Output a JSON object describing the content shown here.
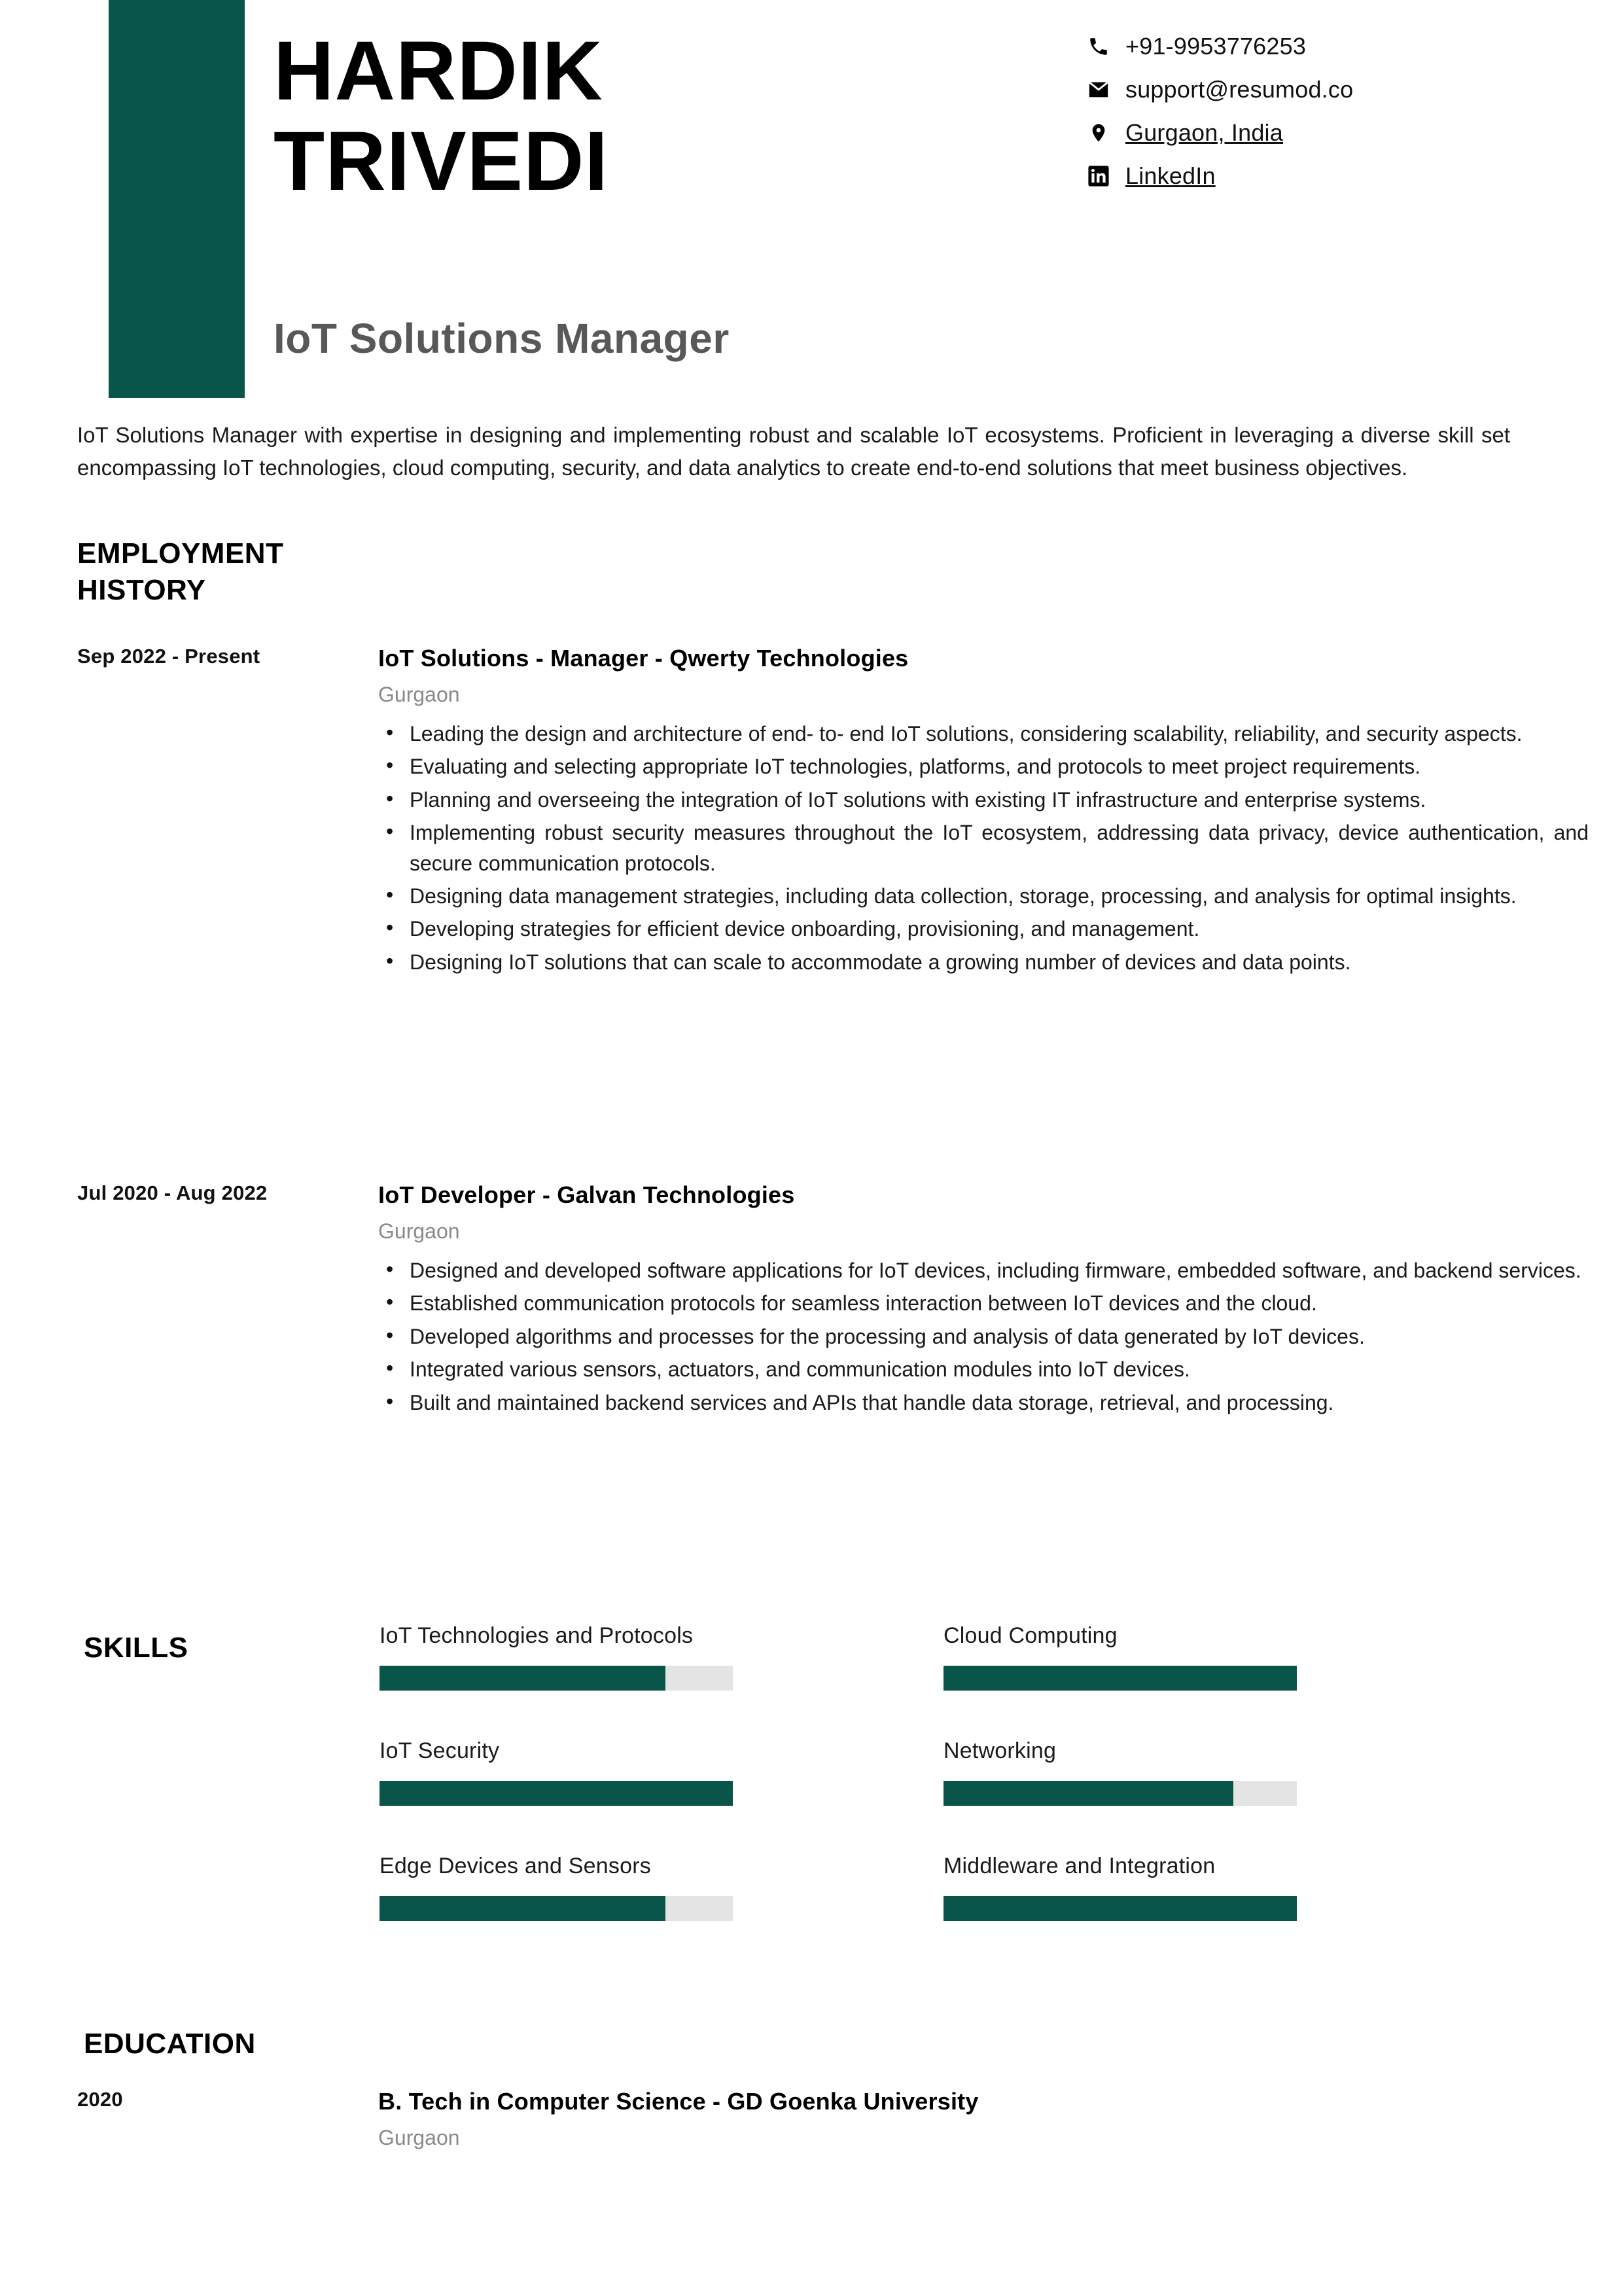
{
  "header": {
    "first_name": "HARDIK",
    "last_name": "TRIVEDI",
    "job_title": "IoT Solutions Manager",
    "accent_color": "#0a5549"
  },
  "contact": [
    {
      "icon": "phone-icon",
      "text": "+91-9953776253",
      "linked": false
    },
    {
      "icon": "envelope-icon",
      "text": "support@resumod.co",
      "linked": false
    },
    {
      "icon": "location-pin-icon",
      "text": "Gurgaon, India",
      "linked": true
    },
    {
      "icon": "linkedin-icon",
      "text": "LinkedIn",
      "linked": true
    }
  ],
  "summary": "IoT Solutions Manager with expertise in designing and implementing robust and scalable IoT ecosystems. Proficient in leveraging a diverse skill set encompassing IoT technologies, cloud computing, security, and data analytics to create end-to-end solutions that meet business objectives.",
  "employment": {
    "section_title": "EMPLOYMENT HISTORY",
    "entries": [
      {
        "date": "Sep 2022 - Present",
        "heading": "IoT Solutions - Manager - Qwerty Technologies",
        "location": "Gurgaon",
        "bullets": [
          "Leading the design and architecture of end- to- end IoT solutions, considering scalability, reliability, and security aspects.",
          "Evaluating and selecting appropriate IoT technologies, platforms, and protocols to meet project requirements.",
          "Planning and overseeing the integration of IoT solutions with existing IT infrastructure and enterprise systems.",
          "Implementing robust security measures throughout the IoT ecosystem, addressing data privacy, device authentication, and secure communication protocols.",
          "Designing data management strategies, including data collection, storage, processing, and analysis for optimal insights.",
          "Developing strategies for efficient device onboarding, provisioning, and management.",
          "Designing IoT solutions that can scale to accommodate a growing number of devices and data points."
        ]
      },
      {
        "date": "Jul 2020 - Aug 2022",
        "heading": "IoT Developer - Galvan Technologies",
        "location": "Gurgaon",
        "bullets": [
          "Designed and developed software applications for IoT devices, including firmware, embedded software, and backend services.",
          "Established communication protocols for seamless interaction between IoT devices and the cloud.",
          "Developed algorithms and processes for the processing and analysis of data generated by IoT devices.",
          "Integrated various sensors, actuators, and communication modules into IoT devices.",
          "Built and maintained backend services and APIs that handle data storage, retrieval, and processing."
        ]
      }
    ]
  },
  "skills": {
    "section_title": "SKILLS",
    "items": [
      {
        "label": "IoT Technologies and Protocols",
        "level": 81
      },
      {
        "label": "Cloud Computing",
        "level": 100
      },
      {
        "label": "IoT Security",
        "level": 100
      },
      {
        "label": "Networking",
        "level": 82
      },
      {
        "label": "Edge Devices and Sensors",
        "level": 81
      },
      {
        "label": "Middleware and Integration",
        "level": 100
      }
    ]
  },
  "education": {
    "section_title": "EDUCATION",
    "entries": [
      {
        "date": "2020",
        "heading": "B. Tech in Computer Science - GD Goenka University",
        "location": "Gurgaon"
      }
    ]
  }
}
